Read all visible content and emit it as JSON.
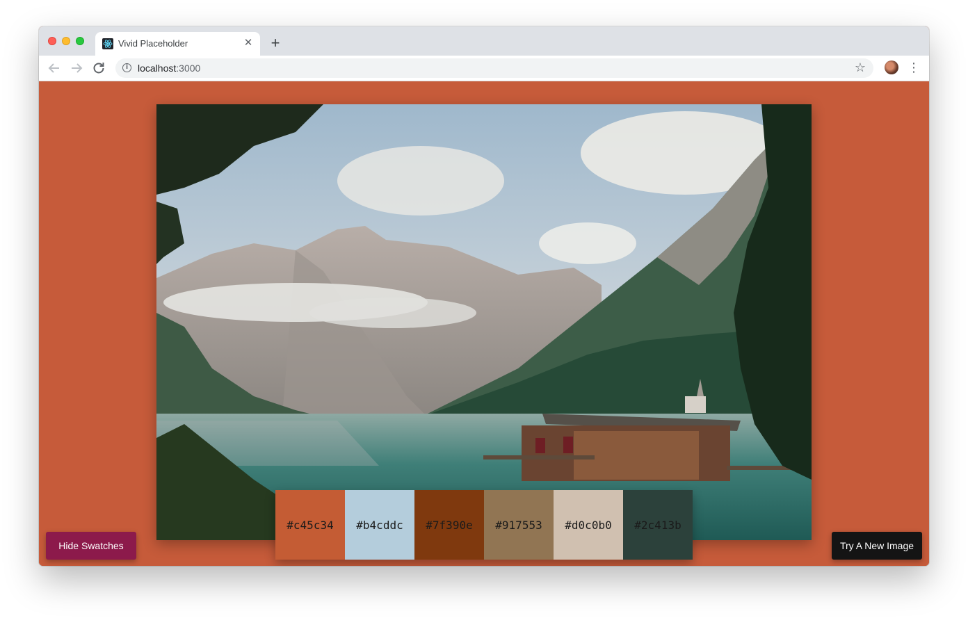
{
  "browser": {
    "tab_title": "Vivid Placeholder",
    "new_tab_symbol": "+",
    "close_symbol": "✕",
    "url_host": "localhost",
    "url_port": ":3000",
    "favicon": "react-icon"
  },
  "colors": {
    "page_background": "#c65b3a",
    "hide_button": "#8c1a4b",
    "try_button": "#141414"
  },
  "swatches": [
    {
      "hex": "#c45c34"
    },
    {
      "hex": "#b4cddc"
    },
    {
      "hex": "#7f390e"
    },
    {
      "hex": "#917553"
    },
    {
      "hex": "#d0c0b0"
    },
    {
      "hex": "#2c413b"
    }
  ],
  "buttons": {
    "hide_swatches": "Hide Swatches",
    "try_new_image": "Try A New Image"
  }
}
